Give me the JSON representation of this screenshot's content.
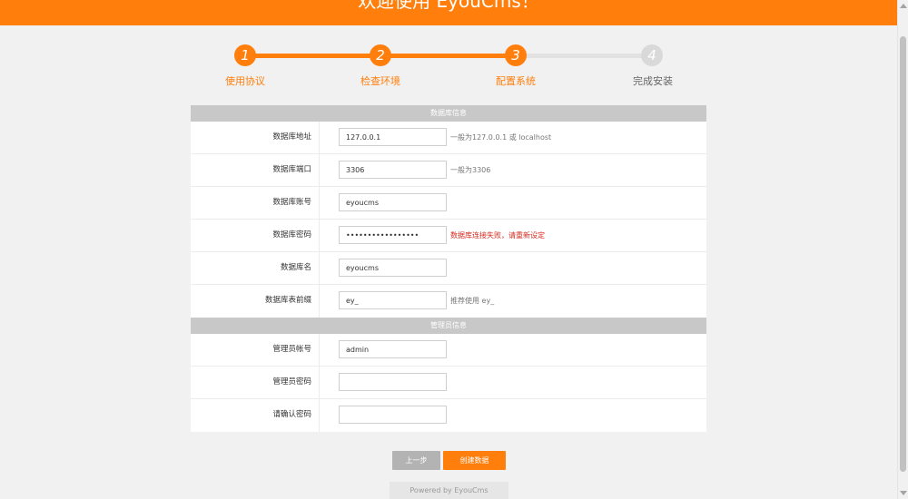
{
  "header": {
    "title": "欢迎使用 EyouCms！"
  },
  "steps": [
    {
      "num": "1",
      "label": "使用协议",
      "state": "done"
    },
    {
      "num": "2",
      "label": "检查环境",
      "state": "done"
    },
    {
      "num": "3",
      "label": "配置系统",
      "state": "done"
    },
    {
      "num": "4",
      "label": "完成安装",
      "state": "todo"
    }
  ],
  "db_section": {
    "title": "数据库信息",
    "fields": [
      {
        "label": "数据库地址",
        "value": "127.0.0.1",
        "hint": "一般为127.0.0.1 或 localhost",
        "error": false
      },
      {
        "label": "数据库端口",
        "value": "3306",
        "hint": "一般为3306",
        "error": false
      },
      {
        "label": "数据库账号",
        "value": "eyoucms",
        "hint": "",
        "error": false
      },
      {
        "label": "数据库密码",
        "value": "•••••••••••••••••",
        "hint": "数据库连接失败，请重新设定",
        "error": true
      },
      {
        "label": "数据库名",
        "value": "eyoucms",
        "hint": "",
        "error": false
      },
      {
        "label": "数据库表前缀",
        "value": "ey_",
        "hint": "推荐使用 ey_",
        "error": false
      }
    ]
  },
  "admin_section": {
    "title": "管理员信息",
    "fields": [
      {
        "label": "管理员帐号",
        "value": "admin"
      },
      {
        "label": "管理员密码",
        "value": ""
      },
      {
        "label": "请确认密码",
        "value": ""
      }
    ]
  },
  "buttons": {
    "prev": "上一步",
    "next": "创建数据"
  },
  "footer": {
    "text": "Powered by EyouCms"
  },
  "colors": {
    "accent": "#ff7e0c",
    "error": "#d8271c",
    "inactive": "#d9d9d9"
  }
}
